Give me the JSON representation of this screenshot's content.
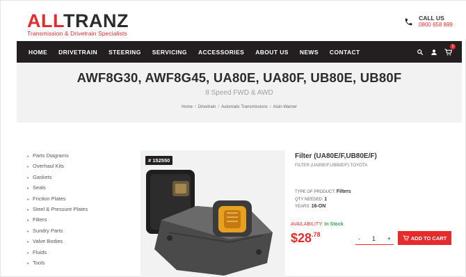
{
  "header": {
    "logo_main_red": "ALL",
    "logo_main_dark": "TRANZ",
    "logo_tagline": "Transmission & Drivetrain Specialists",
    "call_label": "CALL US",
    "call_number": "0800 658 899"
  },
  "nav": {
    "items": [
      "HOME",
      "DRIVETRAIN",
      "STEERING",
      "SERVICING",
      "ACCESSORIES",
      "ABOUT US",
      "NEWS",
      "CONTACT"
    ],
    "cart_count": "1"
  },
  "hero": {
    "title": "AWF8G30, AWF8G45, UA80E, UA80F, UB80E, UB80F",
    "subtitle": "8 Speed FWD & AWD",
    "breadcrumb": [
      "Home",
      "Drivetrain",
      "Automatic Transmissions",
      "Aisin-Warner"
    ]
  },
  "sidebar": {
    "items": [
      "Parts Diagrams",
      "Overhaul Kits",
      "Gaskets",
      "Seals",
      "Friction Plates",
      "Steel & Pressure Plates",
      "Filters",
      "Sundry Parts",
      "Valve Bodies",
      "Fluids",
      "Tools"
    ]
  },
  "product": {
    "sku": "# 152550",
    "title": "Filter (UA80E/F,UB80E/F)",
    "description": "FILTER (UA80E/F,UB80E/F) TOYOTA",
    "type_label": "TYPE OF PRODUCT:",
    "type_value": "Filters",
    "qty_label": "QTY NEEDED:",
    "qty_value": "1",
    "years_label": "YEARS:",
    "years_value": "16-ON",
    "availability_label": "AVAILABILITY:",
    "availability_value": "In Stock",
    "price_dollars": "$28",
    "price_cents": ".78",
    "quantity": "1",
    "minus": "-",
    "plus": "+",
    "add_to_cart": "ADD TO CART"
  },
  "colors": {
    "accent": "#e52b2b",
    "nav_bg": "#231f20",
    "stock": "#2fa84f"
  }
}
